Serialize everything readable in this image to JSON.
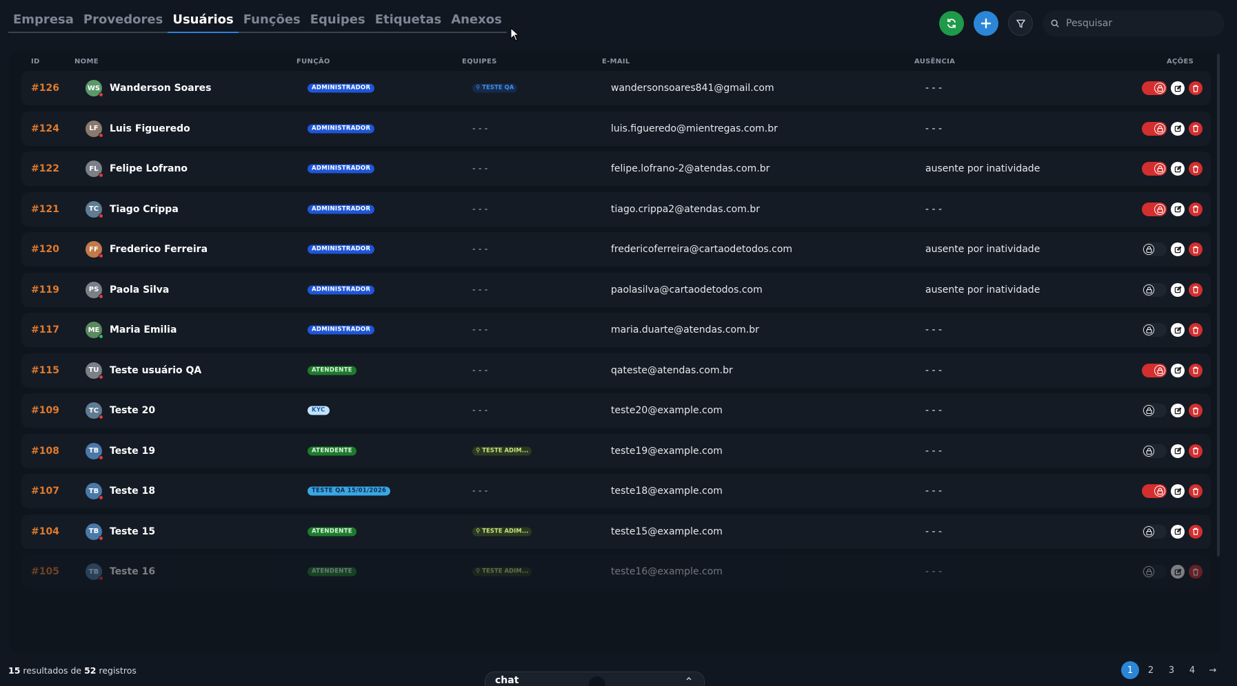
{
  "nav": {
    "tabs": [
      {
        "label": "Empresa"
      },
      {
        "label": "Provedores"
      },
      {
        "label": "Usuários",
        "active": true
      },
      {
        "label": "Funções"
      },
      {
        "label": "Equipes"
      },
      {
        "label": "Etiquetas"
      },
      {
        "label": "Anexos"
      }
    ]
  },
  "toolbar": {
    "search_placeholder": "Pesquisar",
    "icons": [
      "refresh-icon",
      "plus-icon",
      "filter-icon",
      "search-icon"
    ]
  },
  "table": {
    "headers": {
      "id": "ID",
      "nome": "NOME",
      "funcao": "FUNÇÃO",
      "equipes": "EQUIPES",
      "email": "E-MAIL",
      "ausencia": "AUSÊNCIA",
      "acoes": "AÇÕES"
    },
    "rows": [
      {
        "id": "#126",
        "initials": "WS",
        "avatar_color": "#5a9a6a",
        "status": "offline",
        "name": "Wanderson Soares",
        "role": "ADMINISTRADOR",
        "role_type": "admin",
        "team": "TESTE QA",
        "team_type": "qa",
        "email": "wandersonsoares841@gmail.com",
        "absence": "- - -",
        "blocked": true
      },
      {
        "id": "#124",
        "initials": "LF",
        "avatar_color": "#8a7a6e",
        "status": "offline",
        "name": "Luis Figueredo",
        "role": "ADMINISTRADOR",
        "role_type": "admin",
        "team": "- - -",
        "team_type": "none",
        "email": "luis.figueredo@mientregas.com.br",
        "absence": "- - -",
        "blocked": true
      },
      {
        "id": "#122",
        "initials": "FL",
        "avatar_color": "#7a7f88",
        "status": "offline",
        "name": "Felipe Lofrano",
        "role": "ADMINISTRADOR",
        "role_type": "admin",
        "team": "- - -",
        "team_type": "none",
        "email": "felipe.lofrano-2@atendas.com.br",
        "absence": "ausente por inatividade",
        "blocked": true
      },
      {
        "id": "#121",
        "initials": "TC",
        "avatar_color": "#5f7c93",
        "status": "offline",
        "name": "Tiago Crippa",
        "role": "ADMINISTRADOR",
        "role_type": "admin",
        "team": "- - -",
        "team_type": "none",
        "email": "tiago.crippa2@atendas.com.br",
        "absence": "- - -",
        "blocked": true
      },
      {
        "id": "#120",
        "initials": "FF",
        "avatar_color": "#c27a4a",
        "status": "offline",
        "name": "Frederico Ferreira",
        "role": "ADMINISTRADOR",
        "role_type": "admin",
        "team": "- - -",
        "team_type": "none",
        "email": "fredericoferreira@cartaodetodos.com",
        "absence": "ausente por inatividade",
        "blocked": false
      },
      {
        "id": "#119",
        "initials": "PS",
        "avatar_color": "#7a7f88",
        "status": "offline",
        "name": "Paola Silva",
        "role": "ADMINISTRADOR",
        "role_type": "admin",
        "team": "- - -",
        "team_type": "none",
        "email": "paolasilva@cartaodetodos.com",
        "absence": "ausente por inatividade",
        "blocked": false
      },
      {
        "id": "#117",
        "initials": "ME",
        "avatar_color": "#5a8a5e",
        "status": "online",
        "name": "Maria Emilia",
        "role": "ADMINISTRADOR",
        "role_type": "admin",
        "team": "- - -",
        "team_type": "none",
        "email": "maria.duarte@atendas.com.br",
        "absence": "- - -",
        "blocked": false
      },
      {
        "id": "#115",
        "initials": "TU",
        "avatar_color": "#7a7f88",
        "status": "offline",
        "name": "Teste usuário QA",
        "role": "ATENDENTE",
        "role_type": "atend",
        "team": "- - -",
        "team_type": "none",
        "email": "qateste@atendas.com.br",
        "absence": "- - -",
        "blocked": true
      },
      {
        "id": "#109",
        "initials": "TC",
        "avatar_color": "#5f7c93",
        "status": "offline",
        "name": "Teste 20",
        "role": "KYC",
        "role_type": "kyc",
        "team": "- - -",
        "team_type": "none",
        "email": "teste20@example.com",
        "absence": "- - -",
        "blocked": false
      },
      {
        "id": "#108",
        "initials": "TB",
        "avatar_color": "#4a78a8",
        "status": "offline",
        "name": "Teste 19",
        "role": "ATENDENTE",
        "role_type": "atend",
        "team": "TESTE ADIM...",
        "team_type": "adm",
        "email": "teste19@example.com",
        "absence": "- - -",
        "blocked": false
      },
      {
        "id": "#107",
        "initials": "TB",
        "avatar_color": "#4a78a8",
        "status": "offline",
        "name": "Teste 18",
        "role": "TESTE QA 15/01/2026",
        "role_type": "qa",
        "team": "- - -",
        "team_type": "none",
        "email": "teste18@example.com",
        "absence": "- - -",
        "blocked": true
      },
      {
        "id": "#104",
        "initials": "TB",
        "avatar_color": "#4a78a8",
        "status": "offline",
        "name": "Teste 15",
        "role": "ATENDENTE",
        "role_type": "atend",
        "team": "TESTE ADIM...",
        "team_type": "adm",
        "email": "teste15@example.com",
        "absence": "- - -",
        "blocked": false
      },
      {
        "id": "#105",
        "initials": "TB",
        "avatar_color": "#4a78a8",
        "status": "offline",
        "name": "Teste 16",
        "role": "ATENDENTE",
        "role_type": "atend",
        "team": "TESTE ADIM...",
        "team_type": "adm",
        "email": "teste16@example.com",
        "absence": "- - -",
        "blocked": false
      }
    ]
  },
  "footer": {
    "shown": "15",
    "mid": " resultados de ",
    "total": "52",
    "suffix": " registros"
  },
  "chat": {
    "label": "chat"
  },
  "pagination": {
    "pages": [
      "1",
      "2",
      "3",
      "4"
    ],
    "current": "1",
    "next": "→"
  },
  "colors": {
    "accent_blue": "#2b86d8",
    "refresh_green": "#1e9a49",
    "id_orange": "#e07a2e",
    "danger_red": "#d32f2f"
  }
}
